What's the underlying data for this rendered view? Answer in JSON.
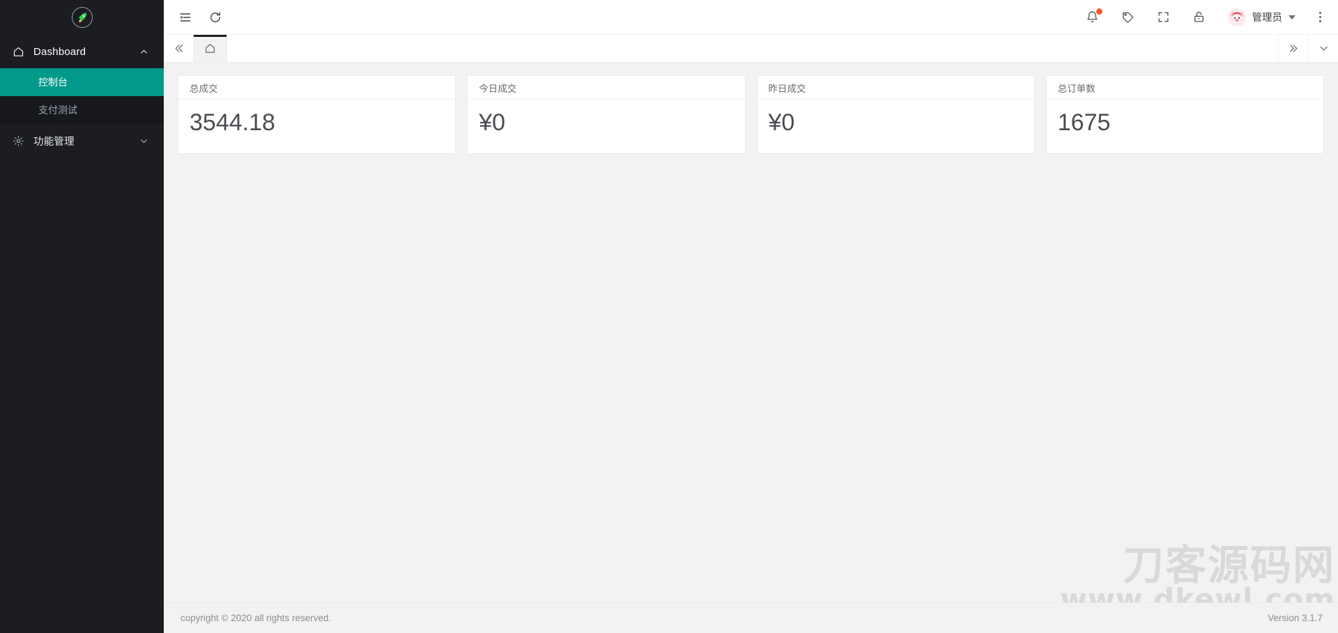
{
  "sidebar": {
    "logo_icon": "rocket-in-circle-logo",
    "menu": [
      {
        "label": "Dashboard",
        "icon": "home-icon",
        "chevron": "chevron-up-icon",
        "expanded": true,
        "children": [
          {
            "label": "控制台",
            "active": true
          },
          {
            "label": "支付测试",
            "active": false
          }
        ]
      },
      {
        "label": "功能管理",
        "icon": "gear-icon",
        "chevron": "chevron-down-icon",
        "expanded": false,
        "children": []
      }
    ],
    "active_accent_color": "#00998a",
    "background_color": "#1b1d23",
    "submenu_background_color": "#16181d"
  },
  "topbar": {
    "left_icons": [
      {
        "name": "menu-fold-icon"
      },
      {
        "name": "refresh-icon"
      }
    ],
    "right_icons": [
      {
        "name": "bell-icon",
        "badge": true,
        "badge_color": "#fc5b2e"
      },
      {
        "name": "tag-icon",
        "badge": false
      },
      {
        "name": "fullscreen-icon",
        "badge": false
      },
      {
        "name": "lock-icon",
        "badge": false
      }
    ],
    "user": {
      "name": "管理员",
      "avatar_icon": "cartoon-pig-avatar",
      "caret": "caret-down-icon"
    },
    "overflow_icon": "kebab-menu-icon"
  },
  "tabbar": {
    "scroll_left_icon": "double-chevron-left-icon",
    "scroll_right_icon": "double-chevron-right-icon",
    "dropdown_icon": "chevron-down-icon",
    "tabs": [
      {
        "icon": "home-icon",
        "label": "",
        "active": true
      }
    ]
  },
  "content": {
    "cards": [
      {
        "title": "总成交",
        "value": "3544.18"
      },
      {
        "title": "今日成交",
        "value": "¥0"
      },
      {
        "title": "昨日成交",
        "value": "¥0"
      },
      {
        "title": "总订单数",
        "value": "1675"
      }
    ]
  },
  "watermark": {
    "line1": "刀客源码网",
    "line2": "www.dkewl.com"
  },
  "footer": {
    "copyright": "copyright © 2020 all rights reserved.",
    "version": "Version 3.1.7"
  }
}
